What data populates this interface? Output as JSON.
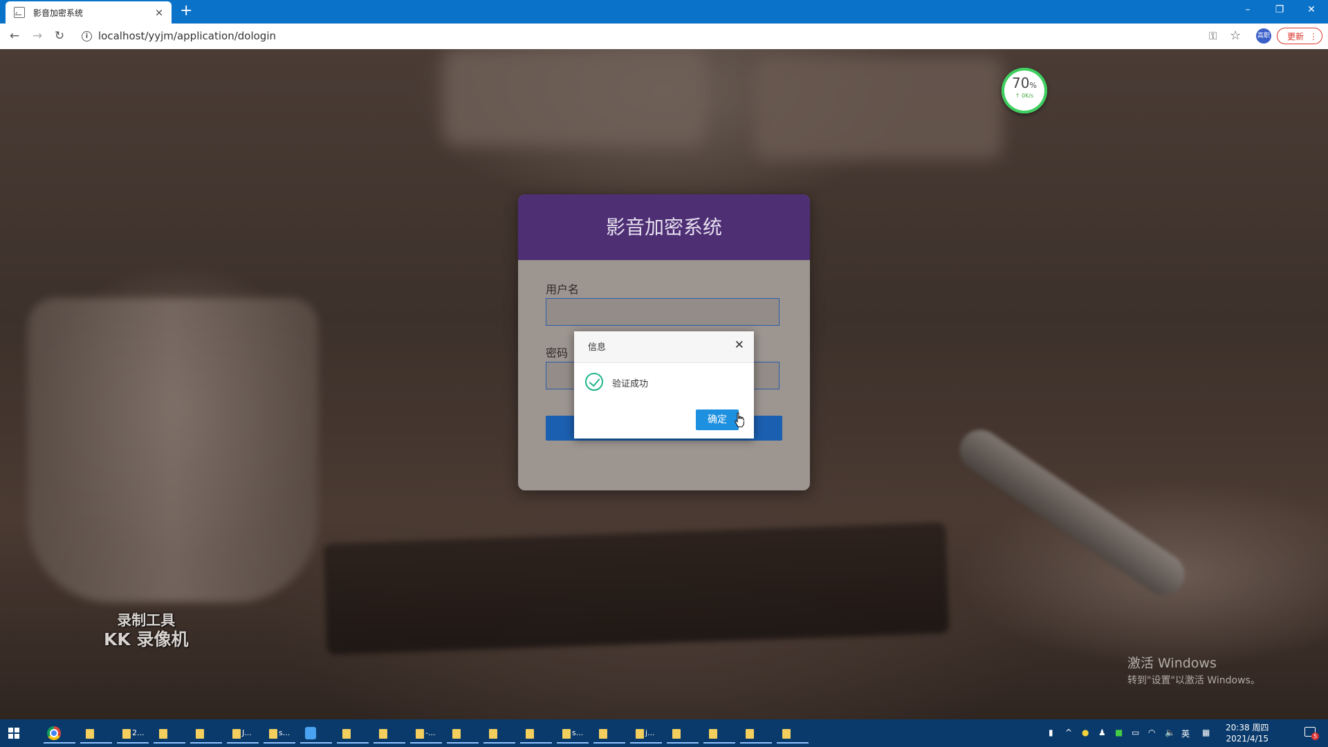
{
  "browser": {
    "tab_title": "影音加密系统",
    "tab_close": "×",
    "new_tab": "+",
    "url": "localhost/yyjm/application/dologin",
    "update_label": "更新",
    "update_menu": "⋮",
    "profile_initials": "高职",
    "window_controls": {
      "minimize": "–",
      "restore": "❐",
      "close": "✕"
    },
    "nav": {
      "back": "←",
      "forward": "→",
      "reload": "↻"
    }
  },
  "speed_widget": {
    "percent": "70",
    "percent_unit": "%",
    "rate": "↑ 0K/s"
  },
  "login": {
    "title": "影音加密系统",
    "username_label": "用户名",
    "password_label": "密码"
  },
  "dialog": {
    "title": "信息",
    "close": "✕",
    "message": "验证成功",
    "ok_label": "确定",
    "status_color": "#1fb38a"
  },
  "watermarks": {
    "recorder_line1": "录制工具",
    "recorder_line2": "KK 录像机",
    "activation_line1": "激活 Windows",
    "activation_line2": "转到\"设置\"以激活 Windows。"
  },
  "taskbar": {
    "items": [
      {
        "icon": "chrome-icon",
        "label": ""
      },
      {
        "icon": "folder-icon",
        "label": ""
      },
      {
        "icon": "folder-icon",
        "label": "2..."
      },
      {
        "icon": "folder-icon",
        "label": ""
      },
      {
        "icon": "folder-icon",
        "label": ""
      },
      {
        "icon": "folder-icon",
        "label": "J..."
      },
      {
        "icon": "folder-icon",
        "label": "s..."
      },
      {
        "icon": "app-icon",
        "label": ""
      },
      {
        "icon": "folder-icon",
        "label": ""
      },
      {
        "icon": "folder-icon",
        "label": ""
      },
      {
        "icon": "folder-icon",
        "label": "-..."
      },
      {
        "icon": "folder-icon",
        "label": ""
      },
      {
        "icon": "folder-icon",
        "label": ""
      },
      {
        "icon": "folder-icon",
        "label": ""
      },
      {
        "icon": "folder-icon",
        "label": "s..."
      },
      {
        "icon": "folder-icon",
        "label": ""
      },
      {
        "icon": "folder-icon",
        "label": "j..."
      },
      {
        "icon": "folder-icon",
        "label": ""
      },
      {
        "icon": "folder-icon",
        "label": ""
      },
      {
        "icon": "folder-icon",
        "label": ""
      },
      {
        "icon": "folder-icon",
        "label": ""
      }
    ],
    "tray_ime": "英",
    "time": "20:38 周四",
    "date": "2021/4/15",
    "notification_count": "5"
  }
}
